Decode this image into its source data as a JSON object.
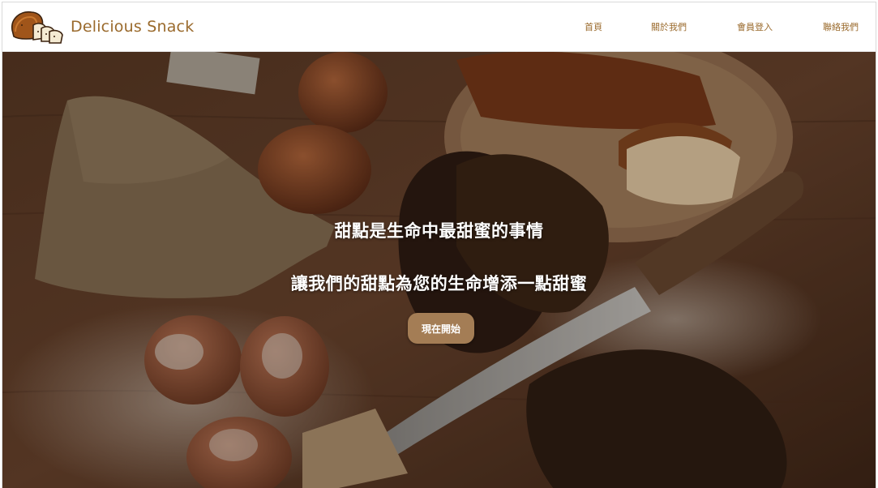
{
  "header": {
    "brand_name": "Delicious Snack",
    "logo_icon": "bread-loaf-icon",
    "nav": [
      {
        "label": "首頁"
      },
      {
        "label": "關於我們"
      },
      {
        "label": "會員登入"
      },
      {
        "label": "聯絡我們"
      }
    ]
  },
  "hero": {
    "title": "甜點是生命中最甜蜜的事情",
    "subtitle": "讓我們的甜點為您的生命增添一點甜蜜",
    "cta_label": "現在開始",
    "background_icon": "bakery-photo",
    "colors": {
      "brand": "#9a6a2c",
      "cta": "#a47d55",
      "text": "#ffffff"
    }
  }
}
